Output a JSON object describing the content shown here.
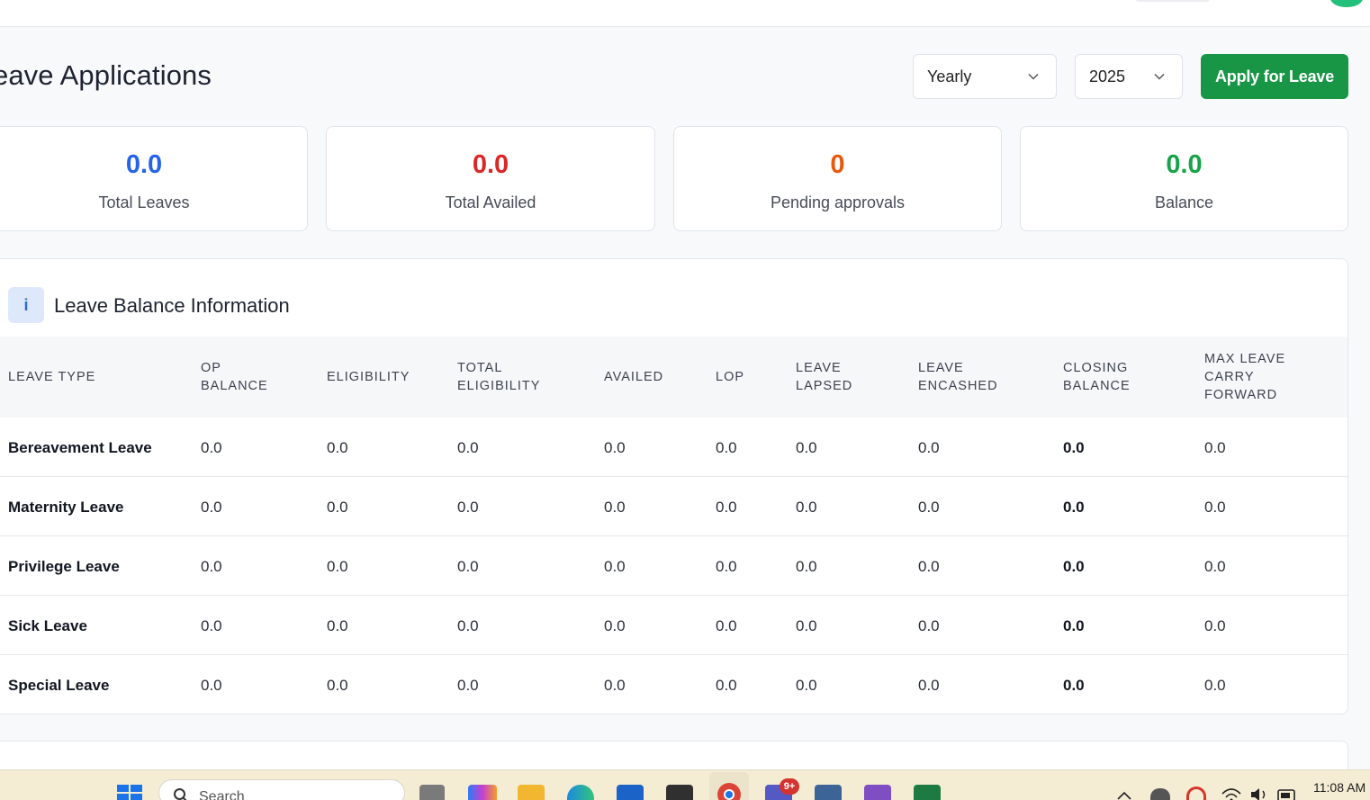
{
  "page": {
    "title": "eave Applications",
    "period_select": "Yearly",
    "year_select": "2025",
    "apply_button": "Apply for Leave"
  },
  "stats": [
    {
      "value": "0.0",
      "label": "Total Leaves",
      "color": "#2563eb"
    },
    {
      "value": "0.0",
      "label": "Total Availed",
      "color": "#dc2626"
    },
    {
      "value": "0",
      "label": "Pending approvals",
      "color": "#ea580c"
    },
    {
      "value": "0.0",
      "label": "Balance",
      "color": "#16a34a"
    }
  ],
  "balance_section": {
    "icon_text": "i",
    "title": "Leave Balance Information",
    "columns": [
      "Leave Type",
      "OP Balance",
      "Eligibility",
      "Total Eligibility",
      "Availed",
      "LOP",
      "Leave Lapsed",
      "Leave Encashed",
      "Closing Balance",
      "Max Leave Carry Forward"
    ],
    "rows": [
      {
        "type": "Bereavement Leave",
        "op": "0.0",
        "eligibility": "0.0",
        "total": "0.0",
        "availed": "0.0",
        "lop": "0.0",
        "lapsed": "0.0",
        "encashed": "0.0",
        "closing": "0.0",
        "max_cf": "0.0"
      },
      {
        "type": "Maternity Leave",
        "op": "0.0",
        "eligibility": "0.0",
        "total": "0.0",
        "availed": "0.0",
        "lop": "0.0",
        "lapsed": "0.0",
        "encashed": "0.0",
        "closing": "0.0",
        "max_cf": "0.0"
      },
      {
        "type": "Privilege Leave",
        "op": "0.0",
        "eligibility": "0.0",
        "total": "0.0",
        "availed": "0.0",
        "lop": "0.0",
        "lapsed": "0.0",
        "encashed": "0.0",
        "closing": "0.0",
        "max_cf": "0.0"
      },
      {
        "type": "Sick Leave",
        "op": "0.0",
        "eligibility": "0.0",
        "total": "0.0",
        "availed": "0.0",
        "lop": "0.0",
        "lapsed": "0.0",
        "encashed": "0.0",
        "closing": "0.0",
        "max_cf": "0.0"
      },
      {
        "type": "Special Leave",
        "op": "0.0",
        "eligibility": "0.0",
        "total": "0.0",
        "availed": "0.0",
        "lop": "0.0",
        "lapsed": "0.0",
        "encashed": "0.0",
        "closing": "0.0",
        "max_cf": "0.0"
      }
    ]
  },
  "taskbar": {
    "search_placeholder": "Search",
    "time": "11:08 AM",
    "teams_badge": "9+",
    "icons": [
      "windows-start-icon",
      "search-icon",
      "task-view-icon",
      "copilot-icon",
      "file-explorer-icon",
      "edge-icon",
      "store-icon",
      "sticky-notes-icon",
      "chrome-icon",
      "teams-icon",
      "postgres-icon",
      "visual-studio-icon",
      "excel-icon",
      "chevron-up-icon",
      "wifi-icon",
      "volume-icon",
      "battery-icon"
    ]
  }
}
